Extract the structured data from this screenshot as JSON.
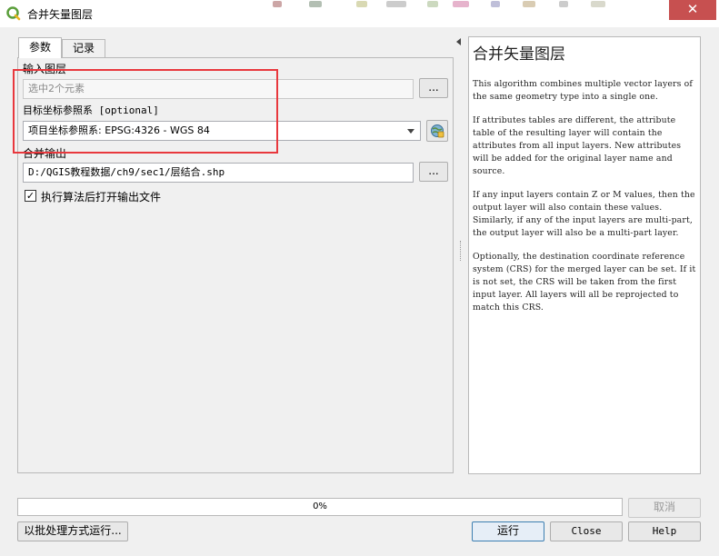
{
  "window": {
    "title": "合并矢量图层",
    "close_glyph": "✕",
    "app_icon": "qgis-icon"
  },
  "tabs": [
    {
      "label": "参数",
      "active": true
    },
    {
      "label": "记录",
      "active": false
    }
  ],
  "params": {
    "input_layers": {
      "label": "输入图层",
      "value": "选中2个元素",
      "browse_label": "..."
    },
    "crs": {
      "label": "目标坐标参照系 [optional]",
      "value": "项目坐标参照系: EPSG:4326 - WGS 84",
      "picker_icon": "globe-crs-icon"
    },
    "output": {
      "label": "合并输出",
      "value": "D:/QGIS教程数据/ch9/sec1/层结合.shp",
      "browse_label": "..."
    },
    "open_output": {
      "checked": true,
      "check_glyph": "✓",
      "label": "执行算法后打开输出文件"
    }
  },
  "help": {
    "title": "合并矢量图层",
    "paragraphs": [
      "This algorithm combines multiple vector layers of the same geometry type into a single one.",
      "If attributes tables are different, the attribute table of the resulting layer will contain the attributes from all input layers. New attributes will be added for the original layer name and source.",
      "If any input layers contain Z or M values, then the output layer will also contain these values. Similarly, if any of the input layers are multi-part, the output layer will also be a multi-part layer.",
      "Optionally, the destination coordinate reference system (CRS) for the merged layer can be set. If it is not set, the CRS will be taken from the first input layer. All layers will all be reprojected to match this CRS."
    ]
  },
  "progress": {
    "value": 0,
    "text": "0%"
  },
  "buttons": {
    "cancel": "取消",
    "batch": "以批处理方式运行...",
    "run": "运行",
    "close": "Close",
    "help": "Help"
  },
  "colors": {
    "highlight": "#e8383d",
    "close_button": "#c75050"
  }
}
